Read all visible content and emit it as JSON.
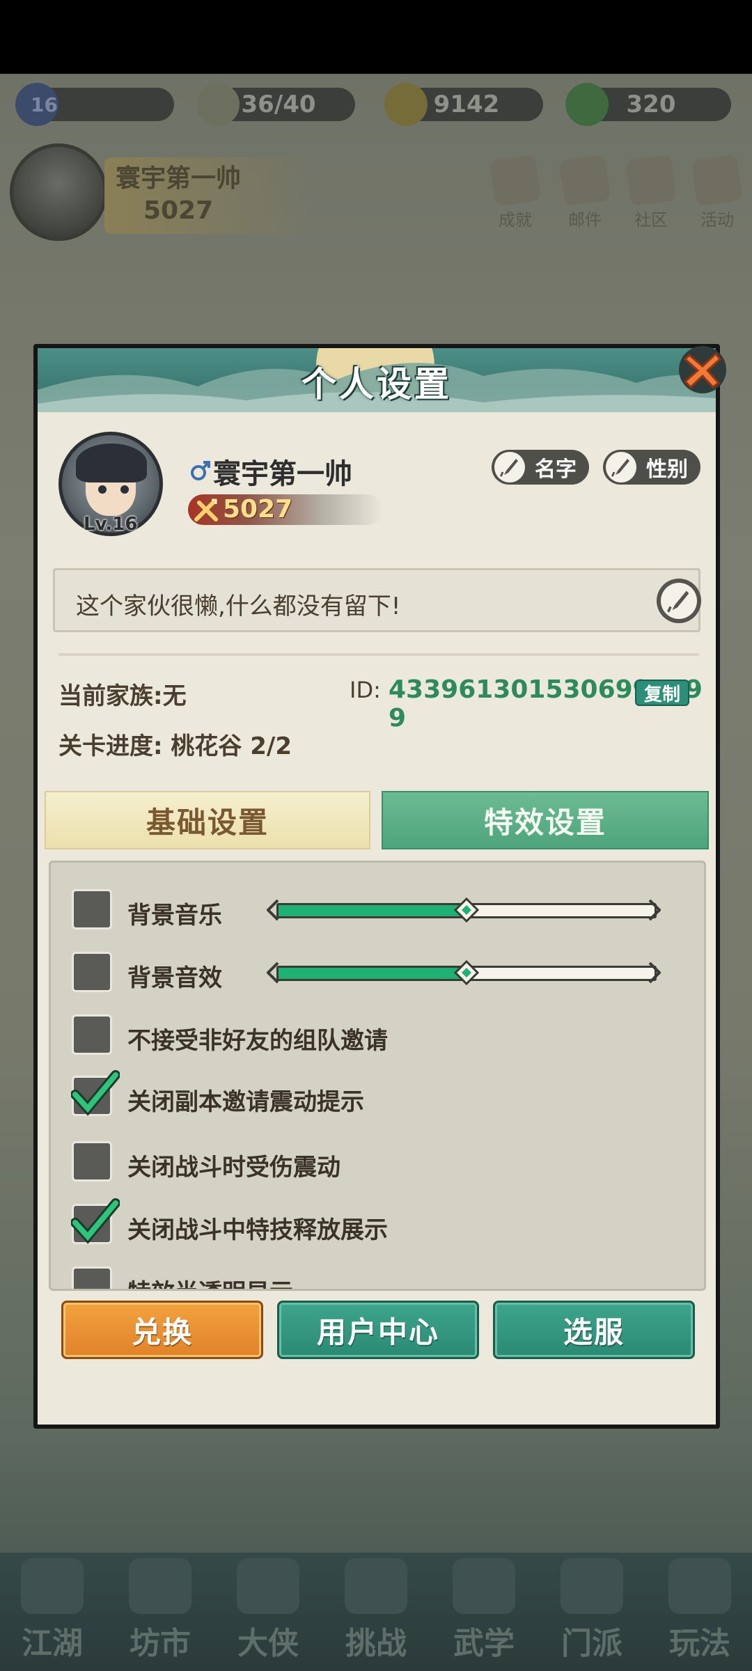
{
  "background": {
    "resources": [
      {
        "value": "16",
        "name": "level"
      },
      {
        "value": "36/40",
        "name": "stamina"
      },
      {
        "value": "9142",
        "name": "copper"
      },
      {
        "value": "320",
        "name": "jade"
      }
    ],
    "player_name": "寰宇第一帅",
    "player_power": "5027",
    "top_buttons": [
      "成就",
      "邮件",
      "社区",
      "活动"
    ],
    "nav": [
      "江湖",
      "坊市",
      "大侠",
      "挑战",
      "武学",
      "门派",
      "玩法"
    ]
  },
  "dialog": {
    "title": "个人设置",
    "profile": {
      "level": "Lv.16",
      "name": "寰宇第一帅",
      "power": "5027",
      "rename_label": "名字",
      "gender_label": "性别"
    },
    "signature": "这个家伙很懒,什么都没有留下!",
    "clan": "当前家族:无",
    "id_label": "ID:",
    "id_value": "433961301530699549​9",
    "copy_label": "复制",
    "stage": "关卡进度: 桃花谷 2/2",
    "tabs": {
      "basic": "基础设置",
      "effects": "特效设置",
      "active": "basic"
    },
    "settings": [
      {
        "label": "背景音乐",
        "checked": false,
        "slider": 0.5
      },
      {
        "label": "背景音效",
        "checked": false,
        "slider": 0.5
      },
      {
        "label": "不接受非好友的组队邀请",
        "checked": false
      },
      {
        "label": "关闭副本邀请震动提示",
        "checked": true
      },
      {
        "label": "关闭战斗时受伤震动",
        "checked": false
      },
      {
        "label": "关闭战斗中特技释放展示",
        "checked": true
      },
      {
        "label": "特效半透明显示",
        "checked": false
      }
    ],
    "buttons": {
      "redeem": "兑换",
      "user_center": "用户中心",
      "select_server": "选服"
    }
  },
  "colors": {
    "accent_green": "#1fb073",
    "header_teal": "#3c7b73",
    "orange_button": "#e0822a",
    "id_green": "#2d8a5b"
  }
}
